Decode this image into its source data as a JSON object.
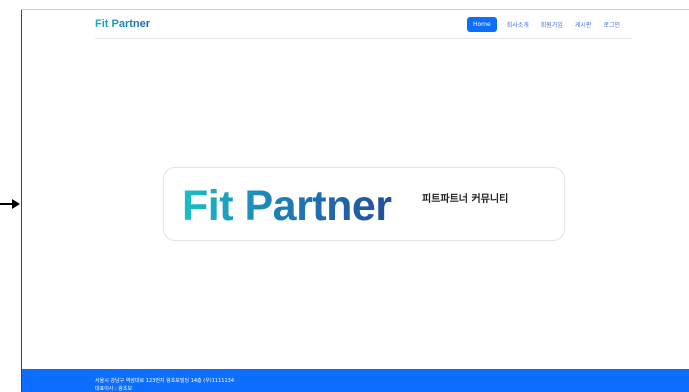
{
  "nav": {
    "brand": "Fit Partner",
    "links": [
      "Home",
      "회사소개",
      "회원가입",
      "게시판",
      "로그인"
    ]
  },
  "hero": {
    "logo": "Fit Partner",
    "subtitle": "피트파트너 커뮤니티"
  },
  "footer": {
    "address": "서울시 강남구 역삼대로 123번지 왕초보빌딩 14층 (우)1111134",
    "ceo": "대표이사 : 왕초보"
  },
  "colors": {
    "primary": "#0d6efd",
    "brand_gradient_start": "#19c0c4",
    "brand_gradient_end": "#224f99"
  }
}
